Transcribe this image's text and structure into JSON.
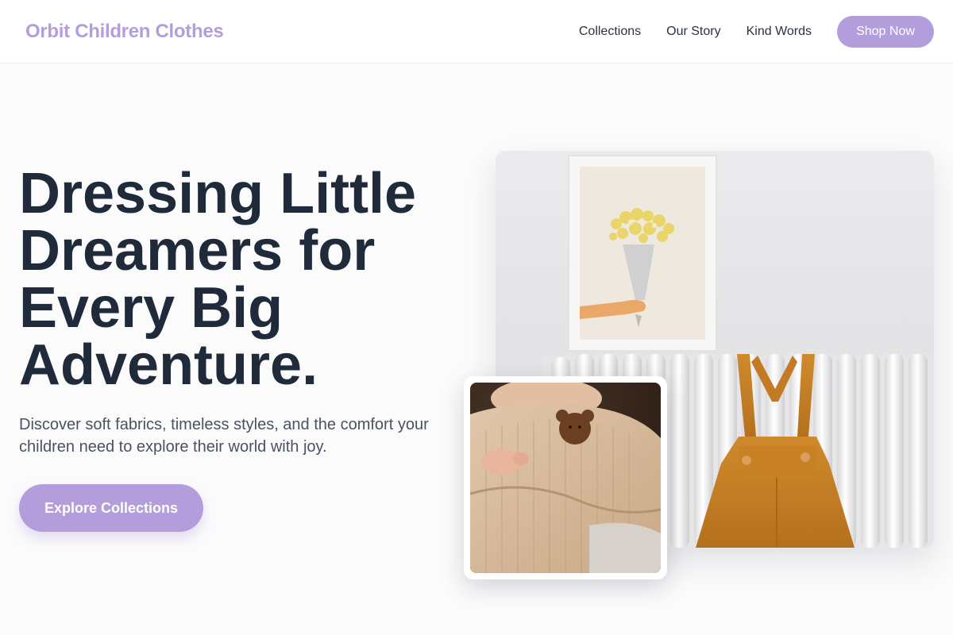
{
  "header": {
    "brand": "Orbit Children Clothes",
    "nav": [
      {
        "label": "Collections"
      },
      {
        "label": "Our Story"
      },
      {
        "label": "Kind Words"
      }
    ],
    "shop_button": "Shop Now"
  },
  "hero": {
    "title_lines": [
      "Dressing Little",
      "Dreamers for",
      "Every Big",
      "Adventure."
    ],
    "subtitle_lines": [
      "Discover soft fabrics, timeless styles, and the comfort your",
      "children need to explore their world with joy."
    ],
    "cta": "Explore Collections"
  },
  "colors": {
    "accent": "#b39ddb",
    "heading": "#1f2a3a",
    "body_text": "#4a5261",
    "background": "#fbfbfc"
  }
}
